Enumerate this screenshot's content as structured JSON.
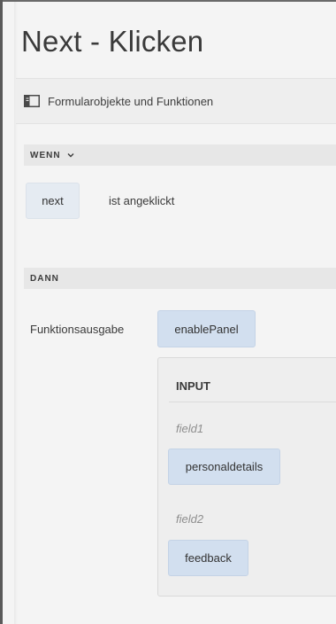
{
  "page": {
    "title": "Next - Klicken"
  },
  "toolbar": {
    "icon": "sidebar-panel-icon",
    "label": "Formularobjekte und Funktionen"
  },
  "when_section": {
    "header": "WENN",
    "chevron_icon": "chevron-down-icon",
    "object_token": "next",
    "condition_text": "ist angeklickt"
  },
  "then_section": {
    "header": "DANN",
    "action_label": "Funktionsausgabe",
    "function_token": "enablePanel",
    "input": {
      "title": "INPUT",
      "fields": [
        {
          "label": "field1",
          "value": "personaldetails"
        },
        {
          "label": "field2",
          "value": "feedback"
        }
      ]
    }
  },
  "colors": {
    "background": "#f4f4f4",
    "token_bg": "#d2dfef",
    "section_header_bg": "#e7e7e7"
  }
}
